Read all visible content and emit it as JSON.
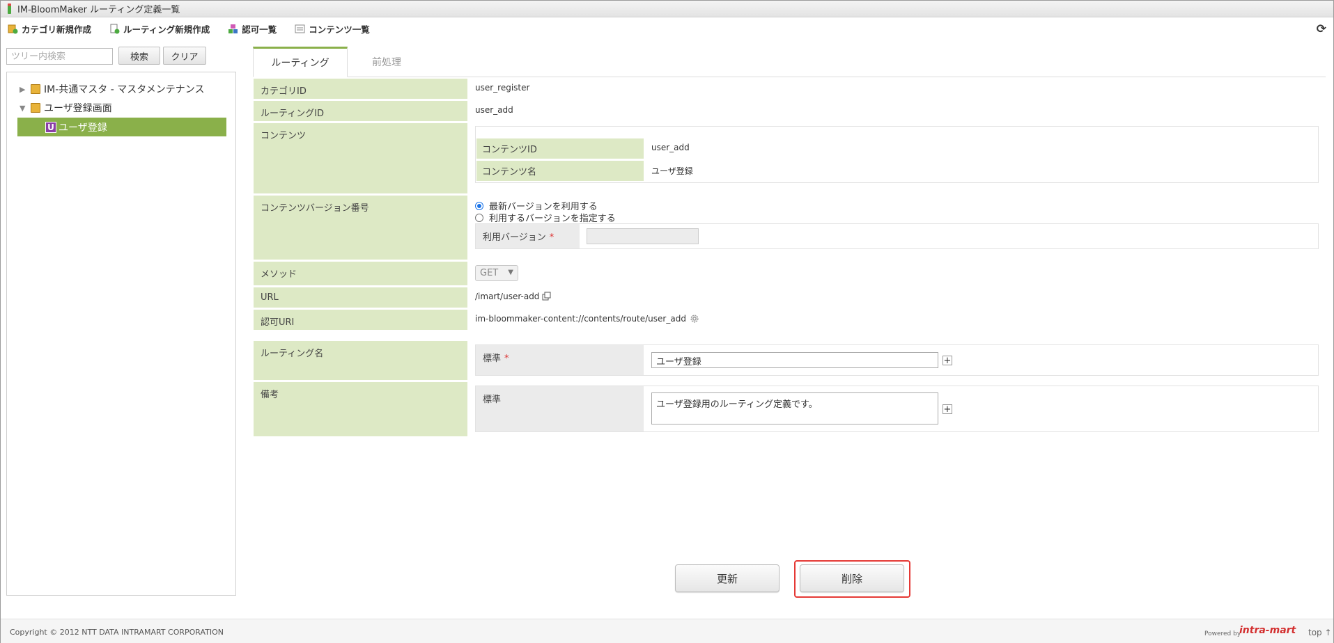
{
  "window": {
    "title": "IM-BloomMaker ルーティング定義一覧"
  },
  "toolbar": {
    "new_category": "カテゴリ新規作成",
    "new_routing": "ルーティング新規作成",
    "auth_list": "認可一覧",
    "content_list": "コンテンツ一覧",
    "refresh_icon": "refresh-icon"
  },
  "search": {
    "placeholder": "ツリー内検索",
    "search_label": "検索",
    "clear_label": "クリア"
  },
  "tree": {
    "items": [
      {
        "label": "IM-共通マスタ - マスタメンテナンス",
        "expanded": false
      },
      {
        "label": "ユーザ登録画面",
        "expanded": true
      },
      {
        "label": "ユーザ登録",
        "selected": true,
        "badge": "U"
      }
    ]
  },
  "tabs": {
    "routing": "ルーティング",
    "preprocess": "前処理"
  },
  "form": {
    "category_id_label": "カテゴリID",
    "category_id": "user_register",
    "routing_id_label": "ルーティングID",
    "routing_id": "user_add",
    "content_label": "コンテンツ",
    "content_id_label": "コンテンツID",
    "content_id": "user_add",
    "content_name_label": "コンテンツ名",
    "content_name": "ユーザ登録",
    "version_label": "コンテンツバージョン番号",
    "version_latest": "最新バージョンを利用する",
    "version_specify": "利用するバージョンを指定する",
    "use_version_label": "利用バージョン",
    "required_mark": "*",
    "method_label": "メソッド",
    "method_value": "GET",
    "url_label": "URL",
    "url_value": "/imart/user-add",
    "auth_uri_label": "認可URI",
    "auth_uri_value": "im-bloommaker-content://contents/route/user_add",
    "routing_name_label": "ルーティング名",
    "standard_label": "標準",
    "routing_name_value": "ユーザ登録",
    "remarks_label": "備考",
    "remarks_value": "ユーザ登録用のルーティング定義です。"
  },
  "actions": {
    "update": "更新",
    "delete": "削除"
  },
  "footer": {
    "copyright": "Copyright © 2012 NTT DATA INTRAMART CORPORATION",
    "powered_by": "Powered by",
    "brand": "intra-mart",
    "top_link": "top ↑"
  },
  "colors": {
    "label_bg": "#dde9c5",
    "selected_tree": "#8ab04a",
    "highlight": "#e53935"
  }
}
